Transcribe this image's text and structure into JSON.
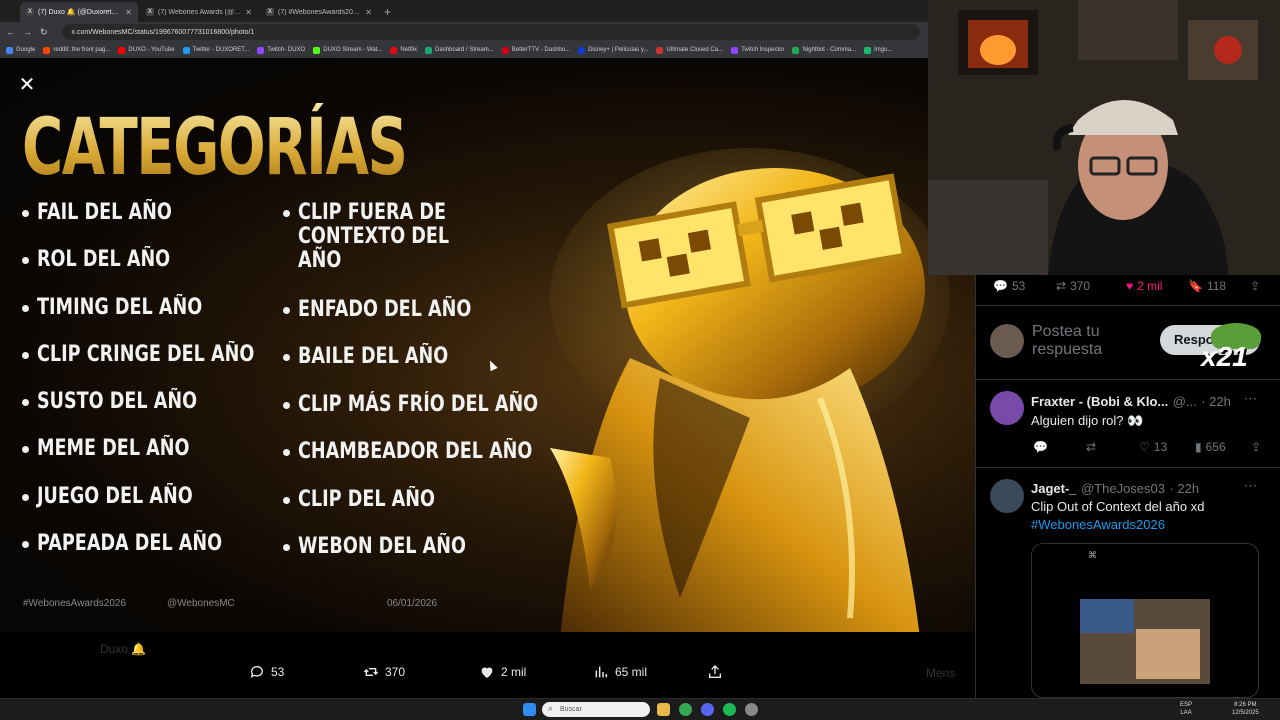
{
  "browser": {
    "tabs": [
      {
        "label": "(7) Duxo 🔔 (@Duxorethey) / X",
        "icon": "X",
        "active": true
      },
      {
        "label": "(7) Webones Awards (@Webon...",
        "icon": "X",
        "active": false
      },
      {
        "label": "(7) #WebonesAwards2026 - Bu...",
        "icon": "X",
        "active": false
      }
    ],
    "new_tab": "+",
    "url": "x.com/WebonesMC/status/1996760077731016800/photo/1",
    "bookmarks": [
      {
        "label": "Google",
        "color": "#4285f4"
      },
      {
        "label": "reddit: the front pag...",
        "color": "#ff4500"
      },
      {
        "label": "DUXO - YouTube",
        "color": "#ff0000"
      },
      {
        "label": "Twitter - DUXORET...",
        "color": "#1d9bf0"
      },
      {
        "label": "Twitch- DUXO",
        "color": "#9146ff"
      },
      {
        "label": "DUXO Stream - Wat...",
        "color": "#53fc18"
      },
      {
        "label": "Netflix",
        "color": "#e50914"
      },
      {
        "label": "Dashboard / Stream...",
        "color": "#19a974"
      },
      {
        "label": "BetterTTV - Dashbo...",
        "color": "#d50014"
      },
      {
        "label": "Disney+ | Películas y...",
        "color": "#113ccf"
      },
      {
        "label": "Ultimate Closed Ca...",
        "color": "#cc3333"
      },
      {
        "label": "Twitch Inspector",
        "color": "#9146ff"
      },
      {
        "label": "Nightbot - Comma...",
        "color": "#22aa55"
      },
      {
        "label": "Imgu...",
        "color": "#1bb76e"
      }
    ]
  },
  "image": {
    "title": "CATEGORÍAS",
    "left_categories": [
      "FAIL DEL AÑO",
      "ROL DEL AÑO",
      "TIMING DEL AÑO",
      "CLIP CRINGE DEL AÑO",
      "SUSTO DEL AÑO",
      "MEME DEL AÑO",
      "JUEGO DEL AÑO",
      "PAPEADA DEL AÑO"
    ],
    "right_categories": [
      "CLIP FUERA DE CONTEXTO DEL AÑO",
      "ENFADO DEL AÑO",
      "BAILE DEL AÑO",
      "CLIP MÁS FRÍO DEL AÑO",
      "CHAMBEADOR DEL AÑO",
      "CLIP DEL AÑO",
      "WEBON DEL AÑO"
    ],
    "hashtag": "#WebonesAwards2026",
    "handle": "@WebonesMC",
    "date": "06/01/2026"
  },
  "actions": {
    "replies": "53",
    "reposts": "370",
    "likes": "2 mil",
    "views": "65 mil"
  },
  "background_ghost": {
    "name": "Duxo 🔔",
    "right": "Mens"
  },
  "feed": {
    "stats": {
      "replies": "53",
      "reposts": "370",
      "likes": "2 mil",
      "bookmarks": "118"
    },
    "reply_placeholder": "Postea tu respuesta",
    "reply_button": "Responder",
    "overlay_badge": "x21",
    "tweets": [
      {
        "name": "Fraxter - (Bobi & Klo...",
        "handle": "@...",
        "time": "· 22h",
        "text": "Alguien dijo rol? 👀",
        "stats": {
          "likes": "13",
          "views": "656"
        }
      },
      {
        "name": "Jaget-_",
        "handle": "@TheJoses03",
        "time": "· 22h",
        "text": "Clip Out of Context del año xd",
        "hashtag": "#WebonesAwards2026"
      }
    ]
  },
  "taskbar": {
    "search": "Buscar",
    "lang": "ESP\nLAA",
    "time": "8:26 PM",
    "date": "12/5/2025"
  }
}
